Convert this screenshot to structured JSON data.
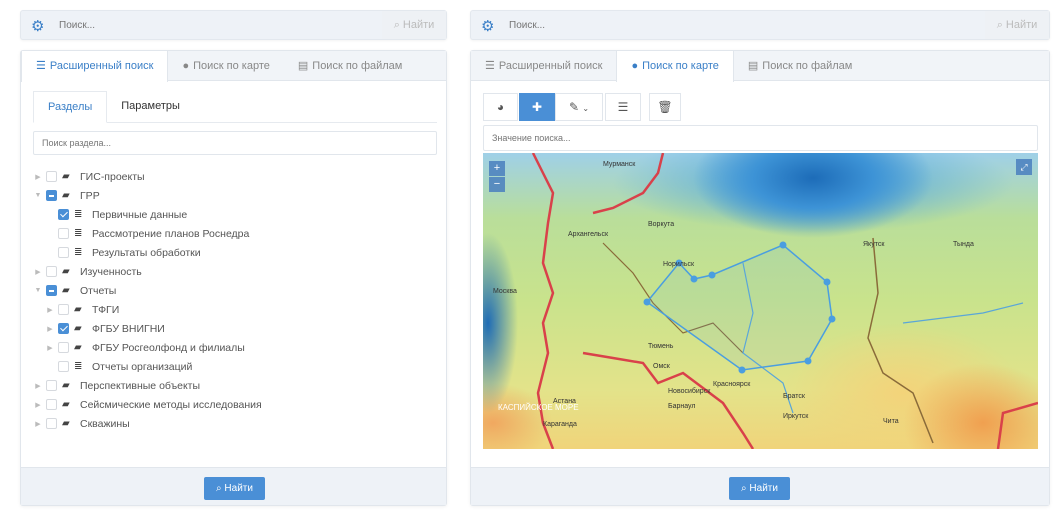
{
  "left": {
    "topbar": {
      "placeholder": "Поиск...",
      "find": "Найти"
    },
    "tabs": [
      {
        "icon": "list-icon",
        "label": "Расширенный поиск"
      },
      {
        "icon": "globe-icon",
        "label": "Поиск по карте"
      },
      {
        "icon": "file-icon",
        "label": "Поиск по файлам"
      }
    ],
    "subtabs": [
      "Разделы",
      "Параметры"
    ],
    "section_search_placeholder": "Поиск раздела...",
    "tree": [
      {
        "label": "ГИС-проекты",
        "level": 0,
        "icon": "folder",
        "state": "off",
        "expandable": true
      },
      {
        "label": "ГРР",
        "level": 0,
        "icon": "folder",
        "state": "partial",
        "expandable": true,
        "expanded": true
      },
      {
        "label": "Первичные данные",
        "level": 1,
        "icon": "database",
        "state": "on"
      },
      {
        "label": "Рассмотрение планов Роснедра",
        "level": 1,
        "icon": "database",
        "state": "off"
      },
      {
        "label": "Результаты обработки",
        "level": 1,
        "icon": "database",
        "state": "off"
      },
      {
        "label": "Изученность",
        "level": 0,
        "icon": "folder",
        "state": "off",
        "expandable": true
      },
      {
        "label": "Отчеты",
        "level": 0,
        "icon": "folder",
        "state": "partial",
        "expandable": true,
        "expanded": true
      },
      {
        "label": "ТФГИ",
        "level": 1,
        "icon": "folder",
        "state": "off",
        "expandable": true
      },
      {
        "label": "ФГБУ ВНИГНИ",
        "level": 1,
        "icon": "folder",
        "state": "on",
        "expandable": true
      },
      {
        "label": "ФГБУ Росгеолфонд и филиалы",
        "level": 1,
        "icon": "folder",
        "state": "off",
        "expandable": true
      },
      {
        "label": "Отчеты организаций",
        "level": 1,
        "icon": "database",
        "state": "off"
      },
      {
        "label": "Перспективные объекты",
        "level": 0,
        "icon": "folder",
        "state": "off",
        "expandable": true
      },
      {
        "label": "Сейсмические методы исследования",
        "level": 0,
        "icon": "folder",
        "state": "off",
        "expandable": true
      },
      {
        "label": "Скважины",
        "level": 0,
        "icon": "folder",
        "state": "off",
        "expandable": true
      }
    ],
    "find_button": "Найти"
  },
  "right": {
    "topbar": {
      "placeholder": "Поиск...",
      "find": "Найти"
    },
    "tabs": [
      {
        "icon": "list-icon",
        "label": "Расширенный поиск"
      },
      {
        "icon": "globe-icon",
        "label": "Поиск по карте"
      },
      {
        "icon": "file-icon",
        "label": "Поиск по файлам"
      }
    ],
    "map_search_placeholder": "Значение поиска...",
    "map": {
      "zoom_in": "+",
      "zoom_out": "−",
      "labels": [
        "Мурманск",
        "Архангельск",
        "Воркута",
        "Норильск",
        "Якутск",
        "Москва",
        "Тюмень",
        "Омск",
        "Новосибирск",
        "Барнаул",
        "Красноярск",
        "Иркутск",
        "Астана",
        "Караганда",
        "КАСПИЙСКОЕ МОРЕ",
        "Тында",
        "Братск",
        "Чита"
      ]
    },
    "find_button": "Найти"
  }
}
